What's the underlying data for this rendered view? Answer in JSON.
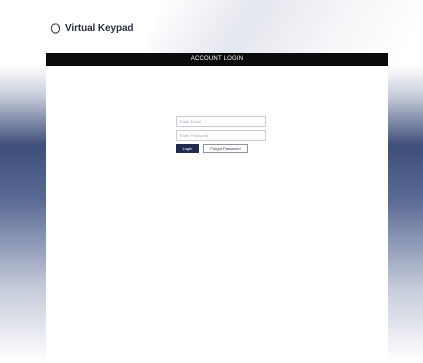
{
  "header": {
    "logo_text": "Virtual Keypad"
  },
  "panel": {
    "title": "ACCOUNT LOGIN"
  },
  "form": {
    "email_placeholder": "Enter Email",
    "password_placeholder": "Enter Password",
    "login_label": "Login",
    "forgot_label": "Forgot Password"
  },
  "colors": {
    "title_bar": "#0b0b0b",
    "login_button": "#1f2a4d",
    "side_gradient": "#3f4f7a"
  }
}
